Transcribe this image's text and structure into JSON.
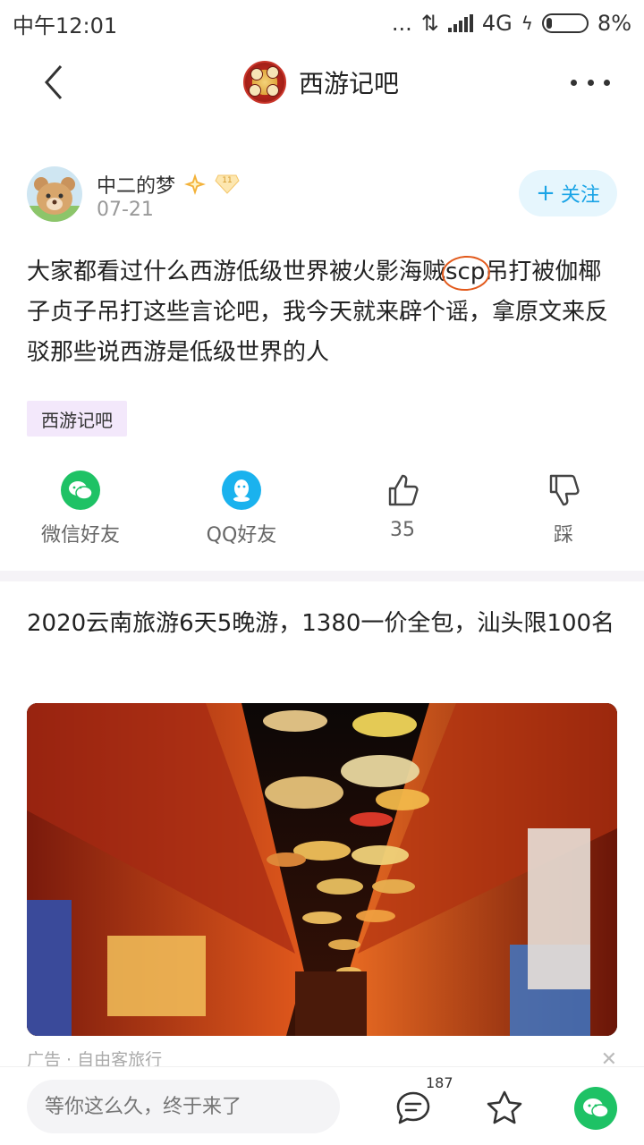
{
  "status_bar": {
    "time": "中午12:01",
    "dots": "...",
    "network": "4G",
    "battery": "8%"
  },
  "nav": {
    "title": "西游记吧"
  },
  "post": {
    "author": "中二的梦",
    "level_badge": "11",
    "date": "07-21",
    "follow_label": "关注",
    "body_before_scp": "大家都看过什么西游低级世界被火影海贼",
    "body_scp": "scp",
    "body_after_scp": "吊打被伽椰子贞子吊打这些言论吧，我今天就来辟个谣，拿原文来反驳那些说西游是低级世界的人",
    "forum_tag": "西游记吧"
  },
  "actions": [
    {
      "label": "微信好友",
      "icon": "wechat-icon"
    },
    {
      "label": "QQ好友",
      "icon": "qq-icon"
    },
    {
      "label": "35",
      "icon": "thumbs-up-icon"
    },
    {
      "label": "踩",
      "icon": "thumbs-down-icon"
    }
  ],
  "ad": {
    "title": "2020云南旅游6天5晚游，1380一价全包，汕头限100名",
    "source": "广告 · 自由客旅行"
  },
  "bottom": {
    "reply_placeholder": "等你这么久，终于来了",
    "comment_count": "187"
  },
  "colors": {
    "accent": "#1aa4e6",
    "wechat": "#1ec265",
    "qq": "#1ab2ee",
    "circle": "#e25a1c"
  }
}
